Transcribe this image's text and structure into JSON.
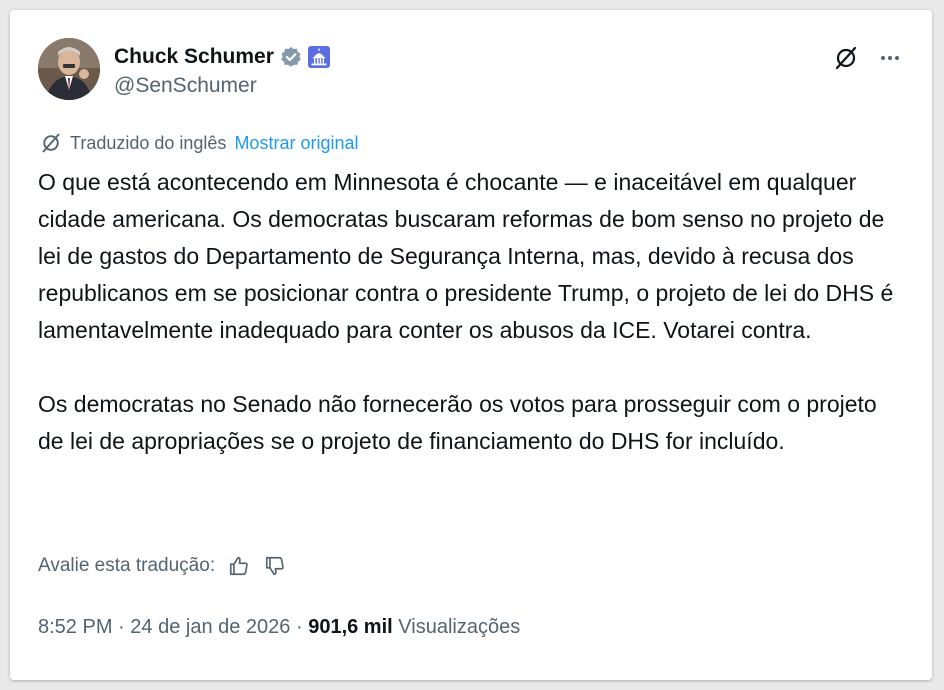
{
  "author": {
    "name": "Chuck Schumer",
    "handle": "@SenSchumer",
    "verified_badge": "verified-badge-icon",
    "affiliation_badge": "capitol-icon"
  },
  "translation": {
    "label": "Traduzido do inglês",
    "show_original": "Mostrar original"
  },
  "tweet": {
    "paragraph1": "O que está acontecendo em Minnesota é chocante — e inaceitável em qualquer cidade americana. Os democratas buscaram reformas de bom senso no projeto de lei de gastos do Departamento de Segurança Interna, mas, devido à recusa dos republicanos em se posicionar contra o presidente Trump, o projeto de lei do DHS é lamentavelmente inadequado para conter os abusos da ICE. Votarei contra.",
    "paragraph2": "Os democratas no Senado não fornecerão os votos para prosseguir com o projeto de lei de apropriações se o projeto de financiamento do DHS for incluído."
  },
  "rating": {
    "label": "Avalie esta tradução:"
  },
  "meta": {
    "time": "8:52 PM",
    "separator1": " · ",
    "date": "24 de jan de 2026",
    "separator2": " · ",
    "views_count": "901,6 mil",
    "views_label": "Visualizações"
  },
  "colors": {
    "accent": "#1d9bf0",
    "secondary_text": "#536471",
    "primary_text": "#0f1419"
  }
}
